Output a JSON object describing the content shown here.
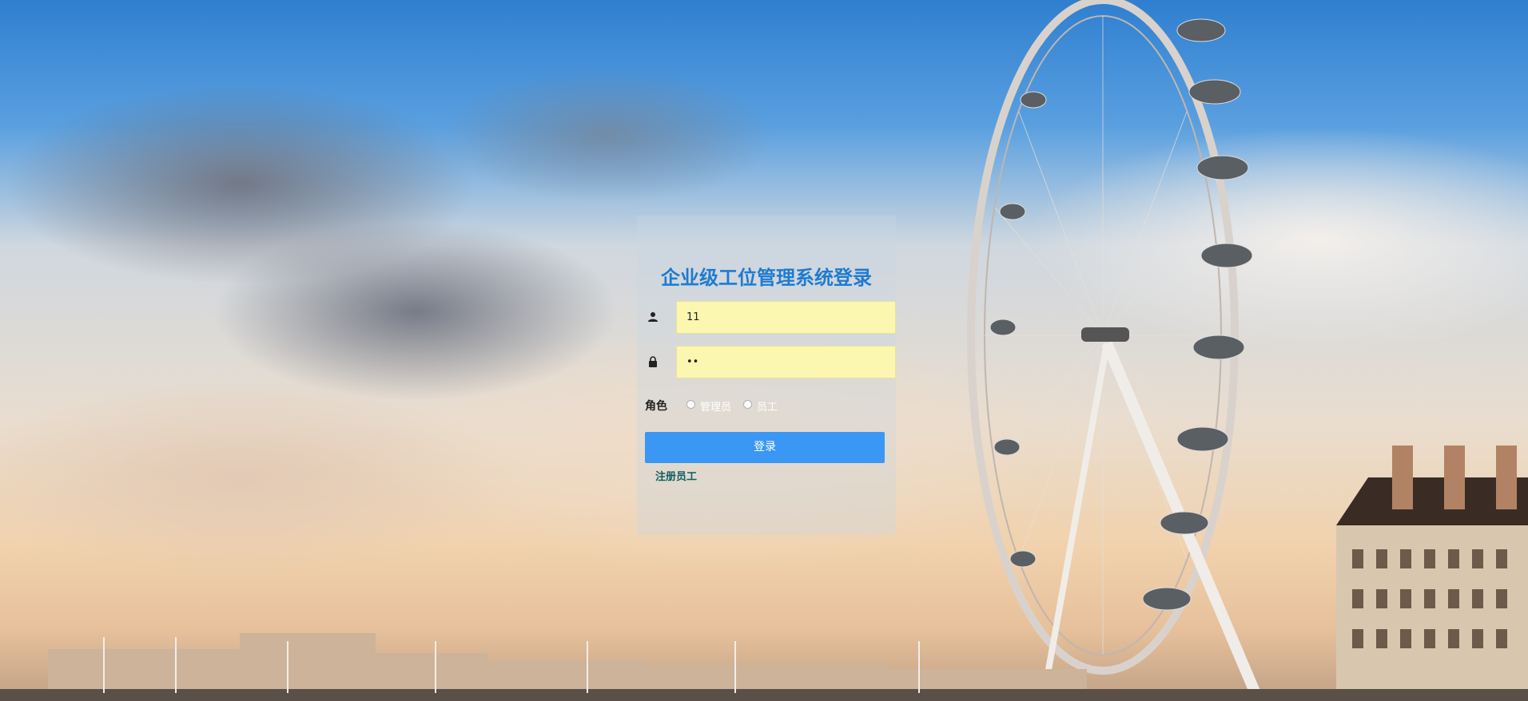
{
  "login": {
    "title": "企业级工位管理系统登录",
    "username_value": "11",
    "password_value": "••",
    "role_label": "角色",
    "role_options": [
      {
        "label": "管理员",
        "selected": false
      },
      {
        "label": "员工",
        "selected": false
      }
    ],
    "login_button": "登录",
    "register_link": "注册员工"
  },
  "icons": {
    "username": "user-icon",
    "password": "lock-icon"
  },
  "colors": {
    "title": "#1f7bd0",
    "input_bg": "#fbf7b0",
    "button_bg": "#3a97f3",
    "register_link": "#0e5f5f"
  }
}
